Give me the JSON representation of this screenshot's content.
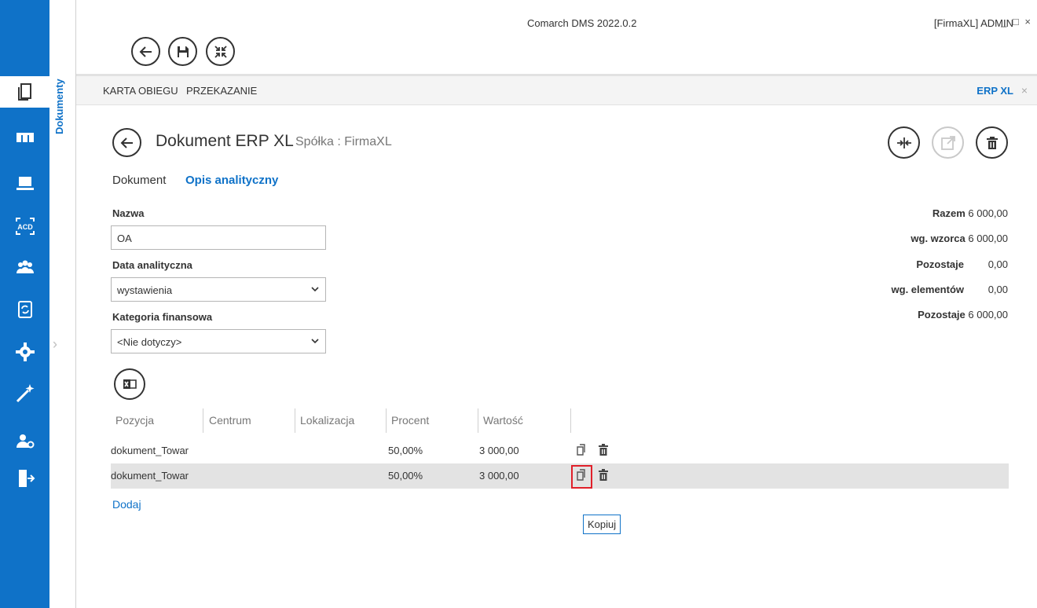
{
  "window": {
    "title": "Comarch DMS 2022.0.2",
    "user": "[FirmaXL]  ADMIN",
    "controls": "_ □ ×"
  },
  "sidebar": {
    "section_label": "Dokumenty",
    "items": [
      {
        "icon": "documents-icon"
      },
      {
        "icon": "workflow-icon"
      },
      {
        "icon": "workstation-icon"
      },
      {
        "icon": "ocr-acd-icon"
      },
      {
        "icon": "users-icon"
      },
      {
        "icon": "document-sync-icon"
      },
      {
        "icon": "gear-icon"
      },
      {
        "icon": "wand-icon"
      },
      {
        "icon": "user-settings-icon"
      },
      {
        "icon": "exit-icon"
      }
    ]
  },
  "tabs": {
    "left": [
      "KARTA OBIEGU",
      "PRZEKAZANIE"
    ],
    "right": "ERP XL",
    "close": "×"
  },
  "header": {
    "title": "Dokument ERP XL",
    "company_label": "Spółka : FirmaXL"
  },
  "subtabs": {
    "items": [
      "Dokument",
      "Opis analityczny"
    ],
    "active": "Opis analityczny"
  },
  "form": {
    "name_label": "Nazwa",
    "name_value": "OA",
    "date_label": "Data analityczna",
    "date_value": "wystawienia",
    "category_label": "Kategoria finansowa",
    "category_value": "<Nie dotyczy>"
  },
  "totals": [
    {
      "label": "Razem",
      "value": "6 000,00"
    },
    {
      "label": "wg. wzorca",
      "value": "6 000,00"
    },
    {
      "label": "Pozostaje",
      "value": "0,00"
    },
    {
      "label": "wg. elementów",
      "value": "0,00"
    },
    {
      "label": "Pozostaje",
      "value": "6 000,00"
    }
  ],
  "table": {
    "headers": [
      "Pozycja",
      "Centrum",
      "Lokalizacja",
      "Procent",
      "Wartość"
    ],
    "rows": [
      {
        "pozycja": "dokument_Towar",
        "centrum": "",
        "lokalizacja": "",
        "procent": "50,00%",
        "wartosc": "3 000,00"
      },
      {
        "pozycja": "dokument_Towar",
        "centrum": "",
        "lokalizacja": "",
        "procent": "50,00%",
        "wartosc": "3 000,00"
      }
    ],
    "add_label": "Dodaj"
  },
  "tooltip": "Kopiuj",
  "colors": {
    "accent": "#0f72c8",
    "highlight": "#e0202a",
    "selected_row": "#e3e3e3"
  }
}
